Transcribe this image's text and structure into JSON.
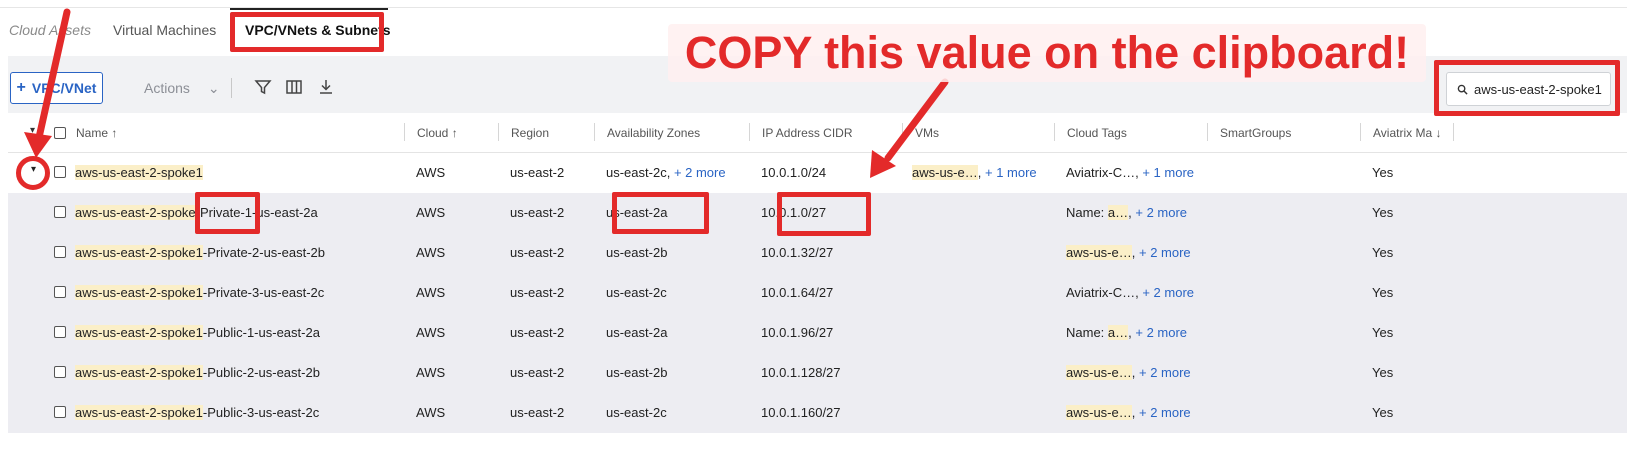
{
  "tabs": {
    "cloud_assets": "Cloud Assets",
    "virtual_machines": "Virtual Machines",
    "vpc_subnets": "VPC/VNets & Subnets"
  },
  "toolbar": {
    "add_label": "VPC/VNet",
    "add_icon": "plus",
    "actions_label": "Actions",
    "actions_chevron": "⌄",
    "filter_icon": "filter-icon",
    "columns_icon": "columns-icon",
    "download_icon": "download-icon"
  },
  "search": {
    "value": "aws-us-east-2-spoke1",
    "icon": "search-icon"
  },
  "annotation": {
    "text": "COPY this value on the clipboard!"
  },
  "columns": {
    "name": "Name",
    "cloud": "Cloud",
    "region": "Region",
    "zones": "Availability Zones",
    "cidr": "IP Address CIDR",
    "vms": "VMs",
    "tags": "Cloud Tags",
    "smartgroups": "SmartGroups",
    "aviatrix": "Aviatrix Ma"
  },
  "rows": [
    {
      "name_hl": "aws-us-east-2-spoke1",
      "name_rest": "",
      "cloud": "AWS",
      "region": "us-east-2",
      "zones": "us-east-2c,",
      "zones_more": "+ 2 more",
      "cidr": "10.0.1.0/24",
      "vms_hl": "aws-us-e…",
      "vms_sep": ",",
      "vms_more": "+ 1 more",
      "tags_value": "Aviatrix-C…",
      "tags_hl": false,
      "tags_more": "+ 1 more",
      "aviatrix": "Yes"
    },
    {
      "name_hl": "aws-us-east-2-spoke",
      "name_rest": "-Private-1-us-east-2a",
      "cloud": "AWS",
      "region": "us-east-2",
      "zones": "us-east-2a",
      "cidr": "10.0.1.0/27",
      "tags_prefix": "Name: ",
      "tags_value": "a…",
      "tags_more": "+ 2 more",
      "aviatrix": "Yes"
    },
    {
      "name_hl": "aws-us-east-2-spoke1",
      "name_rest": "-Private-2-us-east-2b",
      "cloud": "AWS",
      "region": "us-east-2",
      "zones": "us-east-2b",
      "cidr": "10.0.1.32/27",
      "tags_value": "aws-us-e…",
      "tags_more": "+ 2 more",
      "aviatrix": "Yes"
    },
    {
      "name_hl": "aws-us-east-2-spoke1",
      "name_rest": "-Private-3-us-east-2c",
      "cloud": "AWS",
      "region": "us-east-2",
      "zones": "us-east-2c",
      "cidr": "10.0.1.64/27",
      "tags_value": "Aviatrix-C…",
      "tags_more": "+ 2 more",
      "aviatrix": "Yes"
    },
    {
      "name_hl": "aws-us-east-2-spoke1",
      "name_rest": "-Public-1-us-east-2a",
      "cloud": "AWS",
      "region": "us-east-2",
      "zones": "us-east-2a",
      "cidr": "10.0.1.96/27",
      "tags_prefix": "Name: ",
      "tags_value": "a…",
      "tags_more": "+ 2 more",
      "aviatrix": "Yes"
    },
    {
      "name_hl": "aws-us-east-2-spoke1",
      "name_rest": "-Public-2-us-east-2b",
      "cloud": "AWS",
      "region": "us-east-2",
      "zones": "us-east-2b",
      "cidr": "10.0.1.128/27",
      "tags_value": "aws-us-e…",
      "tags_more": "+ 2 more",
      "aviatrix": "Yes"
    },
    {
      "name_hl": "aws-us-east-2-spoke1",
      "name_rest": "-Public-3-us-east-2c",
      "cloud": "AWS",
      "region": "us-east-2",
      "zones": "us-east-2c",
      "cidr": "10.0.1.160/27",
      "tags_value": "aws-us-e…",
      "tags_more": "+ 2 more",
      "aviatrix": "Yes"
    }
  ],
  "colors": {
    "accent": "#2a64c4",
    "highlight": "#fbefc8",
    "annotation_red": "#e32a2a",
    "child_row_bg": "#ededf2"
  }
}
